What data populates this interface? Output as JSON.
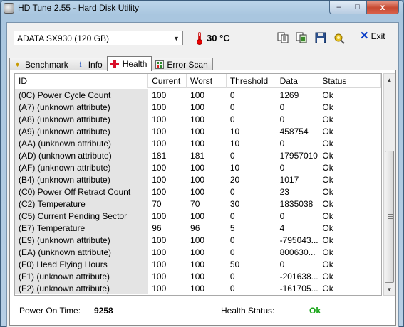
{
  "window": {
    "title": "HD Tune 2.55 - Hard Disk Utility",
    "min_label": "–",
    "max_label": "□",
    "close_label": "x"
  },
  "toolbar": {
    "drive": "ADATA   SX930 (120 GB)",
    "temperature": "30 °C",
    "exit_label": "Exit",
    "icons": [
      "copy-text-icon",
      "copy-screenshot-icon",
      "save-icon",
      "options-icon",
      "exit-icon"
    ]
  },
  "tabs": [
    {
      "label": "Benchmark",
      "icon": "benchmark-icon",
      "active": false
    },
    {
      "label": "Info",
      "icon": "info-icon",
      "active": false
    },
    {
      "label": "Health",
      "icon": "health-cross-icon",
      "active": true
    },
    {
      "label": "Error Scan",
      "icon": "error-scan-icon",
      "active": false
    }
  ],
  "table": {
    "headers": [
      "ID",
      "Current",
      "Worst",
      "Threshold",
      "Data",
      "Status"
    ],
    "rows": [
      [
        "(0C) Power Cycle Count",
        "100",
        "100",
        "0",
        "1269",
        "Ok"
      ],
      [
        "(A7) (unknown attribute)",
        "100",
        "100",
        "0",
        "0",
        "Ok"
      ],
      [
        "(A8) (unknown attribute)",
        "100",
        "100",
        "0",
        "0",
        "Ok"
      ],
      [
        "(A9) (unknown attribute)",
        "100",
        "100",
        "10",
        "458754",
        "Ok"
      ],
      [
        "(AA) (unknown attribute)",
        "100",
        "100",
        "10",
        "0",
        "Ok"
      ],
      [
        "(AD) (unknown attribute)",
        "181",
        "181",
        "0",
        "17957010",
        "Ok"
      ],
      [
        "(AF) (unknown attribute)",
        "100",
        "100",
        "10",
        "0",
        "Ok"
      ],
      [
        "(B4) (unknown attribute)",
        "100",
        "100",
        "20",
        "1017",
        "Ok"
      ],
      [
        "(C0) Power Off Retract Count",
        "100",
        "100",
        "0",
        "23",
        "Ok"
      ],
      [
        "(C2) Temperature",
        "70",
        "70",
        "30",
        "1835038",
        "Ok"
      ],
      [
        "(C5) Current Pending Sector",
        "100",
        "100",
        "0",
        "0",
        "Ok"
      ],
      [
        "(E7) Temperature",
        "96",
        "96",
        "5",
        "4",
        "Ok"
      ],
      [
        "(E9) (unknown attribute)",
        "100",
        "100",
        "0",
        "-795043...",
        "Ok"
      ],
      [
        "(EA) (unknown attribute)",
        "100",
        "100",
        "0",
        "800630...",
        "Ok"
      ],
      [
        "(F0) Head Flying Hours",
        "100",
        "100",
        "50",
        "0",
        "Ok"
      ],
      [
        "(F1) (unknown attribute)",
        "100",
        "100",
        "0",
        "-201638...",
        "Ok"
      ],
      [
        "(F2) (unknown attribute)",
        "100",
        "100",
        "0",
        "-161705...",
        "Ok"
      ]
    ]
  },
  "footer": {
    "power_on_label": "Power On Time:",
    "power_on_value": "9258",
    "health_label": "Health Status:",
    "health_value": "Ok"
  },
  "colors": {
    "health_ok": "#12a312",
    "id_column_bg": "#e4e4e4",
    "close_button": "#c74a32"
  }
}
